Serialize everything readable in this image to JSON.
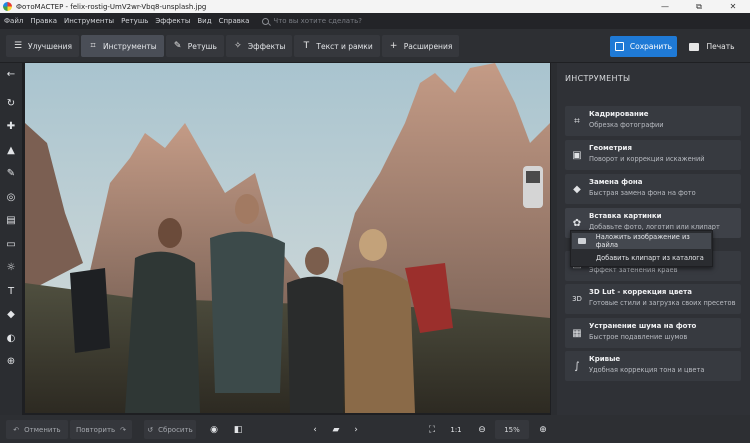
{
  "window": {
    "title": "ФотоМАСТЕР - felix-rostig-UmV2wr-Vbq8-unsplash.jpg",
    "minimize": "—",
    "maximize": "⧉",
    "close": "✕"
  },
  "menu": {
    "items": [
      "Файл",
      "Правка",
      "Инструменты",
      "Ретушь",
      "Эффекты",
      "Вид",
      "Справка"
    ],
    "search_placeholder": "Что вы хотите сделать?"
  },
  "tabs": [
    {
      "label": "Улучшения",
      "icon": "sliders-icon",
      "glyph": "☰"
    },
    {
      "label": "Инструменты",
      "icon": "crop-icon",
      "glyph": "⌗",
      "active": true
    },
    {
      "label": "Ретушь",
      "icon": "brush-icon",
      "glyph": "✎"
    },
    {
      "label": "Эффекты",
      "icon": "magic-wand-icon",
      "glyph": "✧"
    },
    {
      "label": "Текст и рамки",
      "icon": "text-icon",
      "glyph": "T"
    },
    {
      "label": "Расширения",
      "icon": "plus-icon",
      "glyph": "+"
    }
  ],
  "actions": {
    "save": "Сохранить",
    "print": "Печать"
  },
  "left_tools": [
    {
      "name": "back-arrow-icon",
      "glyph": "←"
    },
    {
      "name": "rotate-icon",
      "glyph": "↻"
    },
    {
      "name": "bandage-icon",
      "glyph": "✚"
    },
    {
      "name": "stamp-icon",
      "glyph": "▲"
    },
    {
      "name": "brush-icon",
      "glyph": "✎"
    },
    {
      "name": "radial-filter-icon",
      "glyph": "◎"
    },
    {
      "name": "gradient-filter-icon",
      "glyph": "▤"
    },
    {
      "name": "vignette-icon",
      "glyph": "▭"
    },
    {
      "name": "light-icon",
      "glyph": "☼"
    },
    {
      "name": "text-icon",
      "glyph": "T"
    },
    {
      "name": "fill-icon",
      "glyph": "◆"
    },
    {
      "name": "eraser-icon",
      "glyph": "◐"
    },
    {
      "name": "plus-circle-icon",
      "glyph": "⊕"
    }
  ],
  "panel": {
    "heading": "ИНСТРУМЕНТЫ",
    "tools": [
      {
        "title": "Кадрирование",
        "subtitle": "Обрезка фотографии",
        "icon": "crop-icon",
        "glyph": "⌗"
      },
      {
        "title": "Геометрия",
        "subtitle": "Поворот и коррекция искажений",
        "icon": "geometry-icon",
        "glyph": "▣"
      },
      {
        "title": "Замена фона",
        "subtitle": "Быстрая замена фона на фото",
        "icon": "background-icon",
        "glyph": "◆"
      },
      {
        "title": "Вставка картинки",
        "subtitle": "Добавьте фото, логотип или клипарт",
        "icon": "insert-image-icon",
        "glyph": "✿"
      },
      {
        "title": "",
        "subtitle": "Эффект затенения краев",
        "icon": "vignette-icon",
        "glyph": "▭"
      },
      {
        "title": "3D Lut - коррекция цвета",
        "subtitle": "Готовые стили и загрузка своих пресетов",
        "icon": "lut-cube-icon",
        "glyph": "3D"
      },
      {
        "title": "Устранение шума на фото",
        "subtitle": "Быстрое подавление шумов",
        "icon": "denoise-icon",
        "glyph": "▦"
      },
      {
        "title": "Кривые",
        "subtitle": "Удобная коррекция тона и цвета",
        "icon": "curves-icon",
        "glyph": "∫"
      }
    ],
    "dropdown": {
      "items": [
        "Наложить изображение из файла",
        "Добавить клипарт из каталога"
      ]
    }
  },
  "bottom": {
    "undo": "Отменить",
    "redo": "Повторить",
    "reset": "Сбросить",
    "ratio": "1:1",
    "zoom": "15%"
  }
}
